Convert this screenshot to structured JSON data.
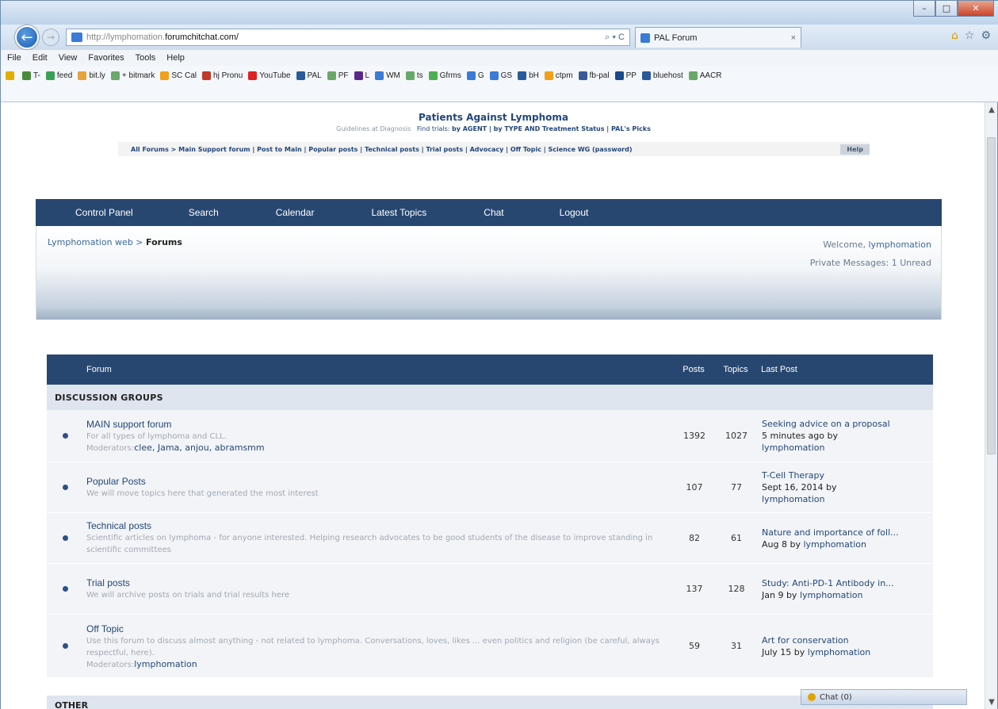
{
  "browser": {
    "url_prefix": "http://lymphomation.",
    "url_domain": "forumchitchat.com/",
    "search_glyph": "⌕ ▾ C",
    "tab_title": "PAL Forum",
    "tab_close": "×",
    "window_buttons": {
      "minimize": "–",
      "maximize": "□",
      "close": "✕"
    },
    "back_glyph": "←",
    "forward_glyph": "→",
    "menu": [
      "File",
      "Edit",
      "View",
      "Favorites",
      "Tools",
      "Help"
    ],
    "favorites": [
      {
        "label": "T-",
        "color": "#4a8a3a"
      },
      {
        "label": "feed",
        "color": "#3aa055"
      },
      {
        "label": "bit.ly",
        "color": "#e6a23c"
      },
      {
        "label": "+ bitmark",
        "color": "#6aa86a"
      },
      {
        "label": "SC Cal",
        "color": "#f2a01c"
      },
      {
        "label": "hj Pronu",
        "color": "#c0392b"
      },
      {
        "label": "YouTube",
        "color": "#d22"
      },
      {
        "label": "PAL",
        "color": "#2a5a9a"
      },
      {
        "label": "PF",
        "color": "#6aa86a"
      },
      {
        "label": "L",
        "color": "#5a2a8a"
      },
      {
        "label": "WM",
        "color": "#3a7bd5"
      },
      {
        "label": "ts",
        "color": "#6aa86a"
      },
      {
        "label": "Gfrms",
        "color": "#4caf50"
      },
      {
        "label": "G",
        "color": "#3a7bd5"
      },
      {
        "label": "GS",
        "color": "#3a7bd5"
      },
      {
        "label": "bH",
        "color": "#2a5a9a"
      },
      {
        "label": "ctpm",
        "color": "#f2a01c"
      },
      {
        "label": "fb-pal",
        "color": "#3b5998"
      },
      {
        "label": "PP",
        "color": "#1a4a8a"
      },
      {
        "label": "bluehost",
        "color": "#2a5a9a"
      },
      {
        "label": "AACR",
        "color": "#6aa86a"
      }
    ]
  },
  "site": {
    "title": "Patients Against Lymphoma",
    "guidelines": "Guidelines at Diagnosis",
    "find_trials": "Find trials:",
    "trial_links": "by AGENT  |  by TYPE AND Treatment Status  |  PAL's Picks",
    "links": "All Forums  > Main Support forum | Post to Main | Popular posts | Technical posts  | Trial posts | Advocacy |  Off Topic | Science WG (password)",
    "help": "Help"
  },
  "nav": [
    "Control Panel",
    "Search",
    "Calendar",
    "Latest Topics",
    "Chat",
    "Logout"
  ],
  "breadcrumb": {
    "root": "Lymphomation web",
    "sep": " > ",
    "current": "Forums"
  },
  "welcome": {
    "label": "Welcome, ",
    "user": "lymphomation",
    "pm": "Private Messages: 1 Unread"
  },
  "table": {
    "headers": {
      "forum": "Forum",
      "posts": "Posts",
      "topics": "Topics",
      "last": "Last Post"
    },
    "group": "DISCUSSION GROUPS",
    "rows": [
      {
        "name": "MAIN support forum",
        "desc": "For all types of lymphoma and CLL.",
        "mods_label": "Moderators:",
        "mods": "clee, Jama, anjou, abramsmm",
        "posts": "1392",
        "topics": "1027",
        "last_title": "Seeking advice on a proposal",
        "last_date": "5 minutes ago by",
        "last_by": "lymphomation"
      },
      {
        "name": "Popular Posts",
        "desc": "We will move topics here that generated the most interest",
        "posts": "107",
        "topics": "77",
        "last_title": "T-Cell Therapy",
        "last_date": "Sept 16, 2014 by",
        "last_by": "lymphomation"
      },
      {
        "name": "Technical posts",
        "desc": "Scientific articles on lymphoma - for anyone interested. Helping research advocates to be good students of the disease to improve standing in scientific committees",
        "posts": "82",
        "topics": "61",
        "last_title": "Nature and importance of foll...",
        "last_date": "Aug 8 by",
        "last_by": "lymphomation"
      },
      {
        "name": "Trial posts",
        "desc": "We will archive posts on trials and trial results here",
        "posts": "137",
        "topics": "128",
        "last_title": "Study: Anti-PD-1 Antibody in...",
        "last_date": "Jan 9 by",
        "last_by": "lymphomation"
      },
      {
        "name": "Off Topic",
        "desc": "Use this forum to discuss almost anything - not related to lymphoma. Conversations, loves, likes ... even politics and religion (be careful, always respectful, here).",
        "mods_label": "Moderators:",
        "mods": "lymphomation",
        "posts": "59",
        "topics": "31",
        "last_title": "Art for conservation",
        "last_date": "July 15 by",
        "last_by": "lymphomation"
      }
    ],
    "group2": "OTHER"
  },
  "chat_pill": "Chat (0)"
}
